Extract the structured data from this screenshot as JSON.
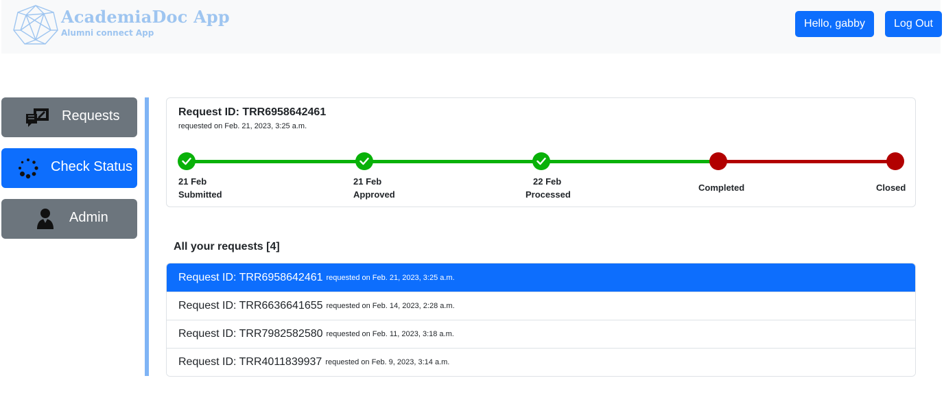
{
  "header": {
    "brand_title": "AcademiaDoc App",
    "brand_subtitle": "Alumni connect App",
    "logo_icon": "geodesic-sphere-logo",
    "hello_button": "Hello, gabby",
    "logout_button": "Log Out"
  },
  "sidebar": {
    "items": [
      {
        "label": "Requests",
        "icon": "requests-icon",
        "active": false
      },
      {
        "label": "Check Status",
        "icon": "spinner-icon",
        "active": true
      },
      {
        "label": "Admin",
        "icon": "user-icon",
        "active": false
      }
    ]
  },
  "current_request": {
    "title": "Request ID: TRR6958642461",
    "requested_on": "requested on Feb. 21, 2023, 3:25 a.m.",
    "steps": [
      {
        "date": "21 Feb",
        "label": "Submitted",
        "status": "done"
      },
      {
        "date": "21 Feb",
        "label": "Approved",
        "status": "done"
      },
      {
        "date": "22 Feb",
        "label": "Processed",
        "status": "done"
      },
      {
        "date": "",
        "label": "Completed",
        "status": "pending"
      },
      {
        "date": "",
        "label": "Closed",
        "status": "pending"
      }
    ]
  },
  "requests_list": {
    "title": "All your requests [4]",
    "items": [
      {
        "id": "Request ID: TRR6958642461",
        "date": "requested on Feb. 21, 2023, 3:25 a.m.",
        "active": true
      },
      {
        "id": "Request ID: TRR6636641655",
        "date": "requested on Feb. 14, 2023, 2:28 a.m.",
        "active": false
      },
      {
        "id": "Request ID: TRR7982582580",
        "date": "requested on Feb. 11, 2023, 3:18 a.m.",
        "active": false
      },
      {
        "id": "Request ID: TRR4011839937",
        "date": "requested on Feb. 9, 2023, 3:14 a.m.",
        "active": false
      }
    ]
  },
  "colors": {
    "primary": "#0d6efd",
    "secondary": "#6c757d",
    "step_done": "#09b109",
    "step_pending": "#b20000",
    "brand": "#9ec5f0",
    "divider": "#7fb4f5"
  }
}
